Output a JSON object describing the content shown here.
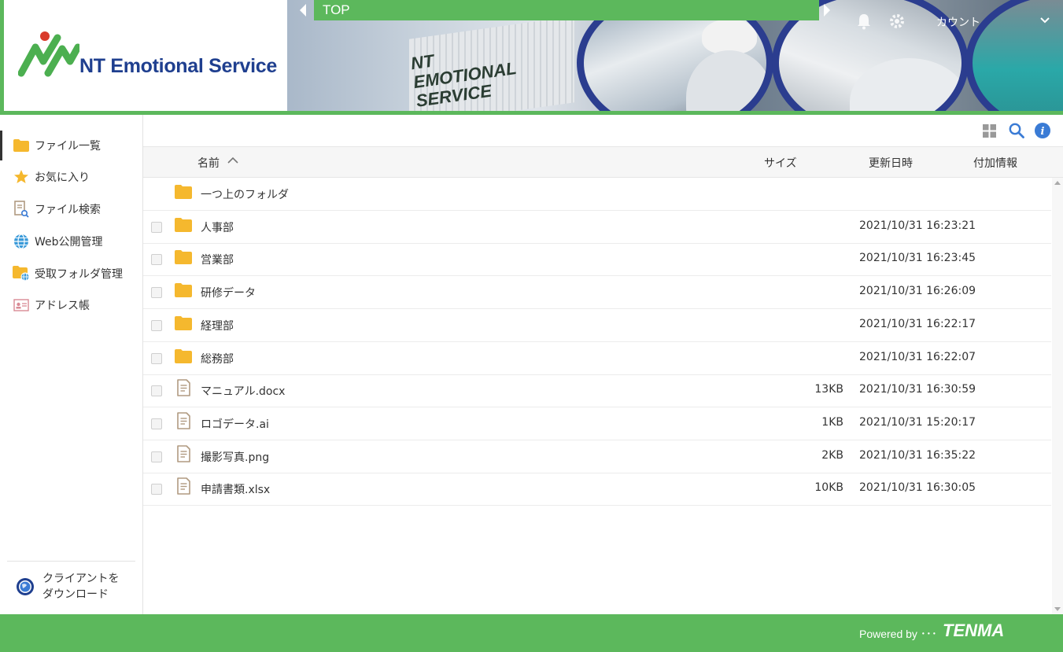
{
  "header": {
    "brand": "NT Emotional Service",
    "banner_sign": [
      "NT",
      "EMOTIONAL",
      "SERVICE"
    ],
    "breadcrumb": "TOP",
    "account_label": "カウント"
  },
  "sidebar": {
    "items": [
      {
        "label": "ファイル一覧",
        "icon": "folder-icon",
        "active": true
      },
      {
        "label": "お気に入り",
        "icon": "star-icon"
      },
      {
        "label": "ファイル検索",
        "icon": "file-search-icon"
      },
      {
        "label": "Web公開管理",
        "icon": "globe-icon"
      },
      {
        "label": "受取フォルダ管理",
        "icon": "folder-globe-icon"
      },
      {
        "label": "アドレス帳",
        "icon": "address-card-icon"
      }
    ],
    "download": {
      "line1": "クライアントを",
      "line2": "ダウンロード",
      "icon": "download-globe-icon"
    }
  },
  "table": {
    "columns": {
      "name": "名前",
      "size": "サイズ",
      "updated": "更新日時",
      "info": "付加情報"
    },
    "up_folder": "一つ上のフォルダ",
    "rows": [
      {
        "type": "folder",
        "name": "人事部",
        "size": "",
        "updated": "2021/10/31 16:23:21"
      },
      {
        "type": "folder",
        "name": "営業部",
        "size": "",
        "updated": "2021/10/31 16:23:45"
      },
      {
        "type": "folder",
        "name": "研修データ",
        "size": "",
        "updated": "2021/10/31 16:26:09"
      },
      {
        "type": "folder",
        "name": "経理部",
        "size": "",
        "updated": "2021/10/31 16:22:17"
      },
      {
        "type": "folder",
        "name": "総務部",
        "size": "",
        "updated": "2021/10/31 16:22:07"
      },
      {
        "type": "file",
        "name": "マニュアル.docx",
        "size": "13KB",
        "updated": "2021/10/31 16:30:59"
      },
      {
        "type": "file",
        "name": "ロゴデータ.ai",
        "size": "1KB",
        "updated": "2021/10/31 15:20:17"
      },
      {
        "type": "file",
        "name": "撮影写真.png",
        "size": "2KB",
        "updated": "2021/10/31 16:35:22"
      },
      {
        "type": "file",
        "name": "申請書類.xlsx",
        "size": "10KB",
        "updated": "2021/10/31 16:30:05"
      }
    ]
  },
  "footer": {
    "powered_by": "Powered by ･･･",
    "brand": "TENMA"
  },
  "colors": {
    "accent_green": "#5cb85c",
    "folder_yellow": "#f5b82e",
    "logo_blue": "#1f3f8f",
    "info_blue": "#3a7bd5"
  }
}
